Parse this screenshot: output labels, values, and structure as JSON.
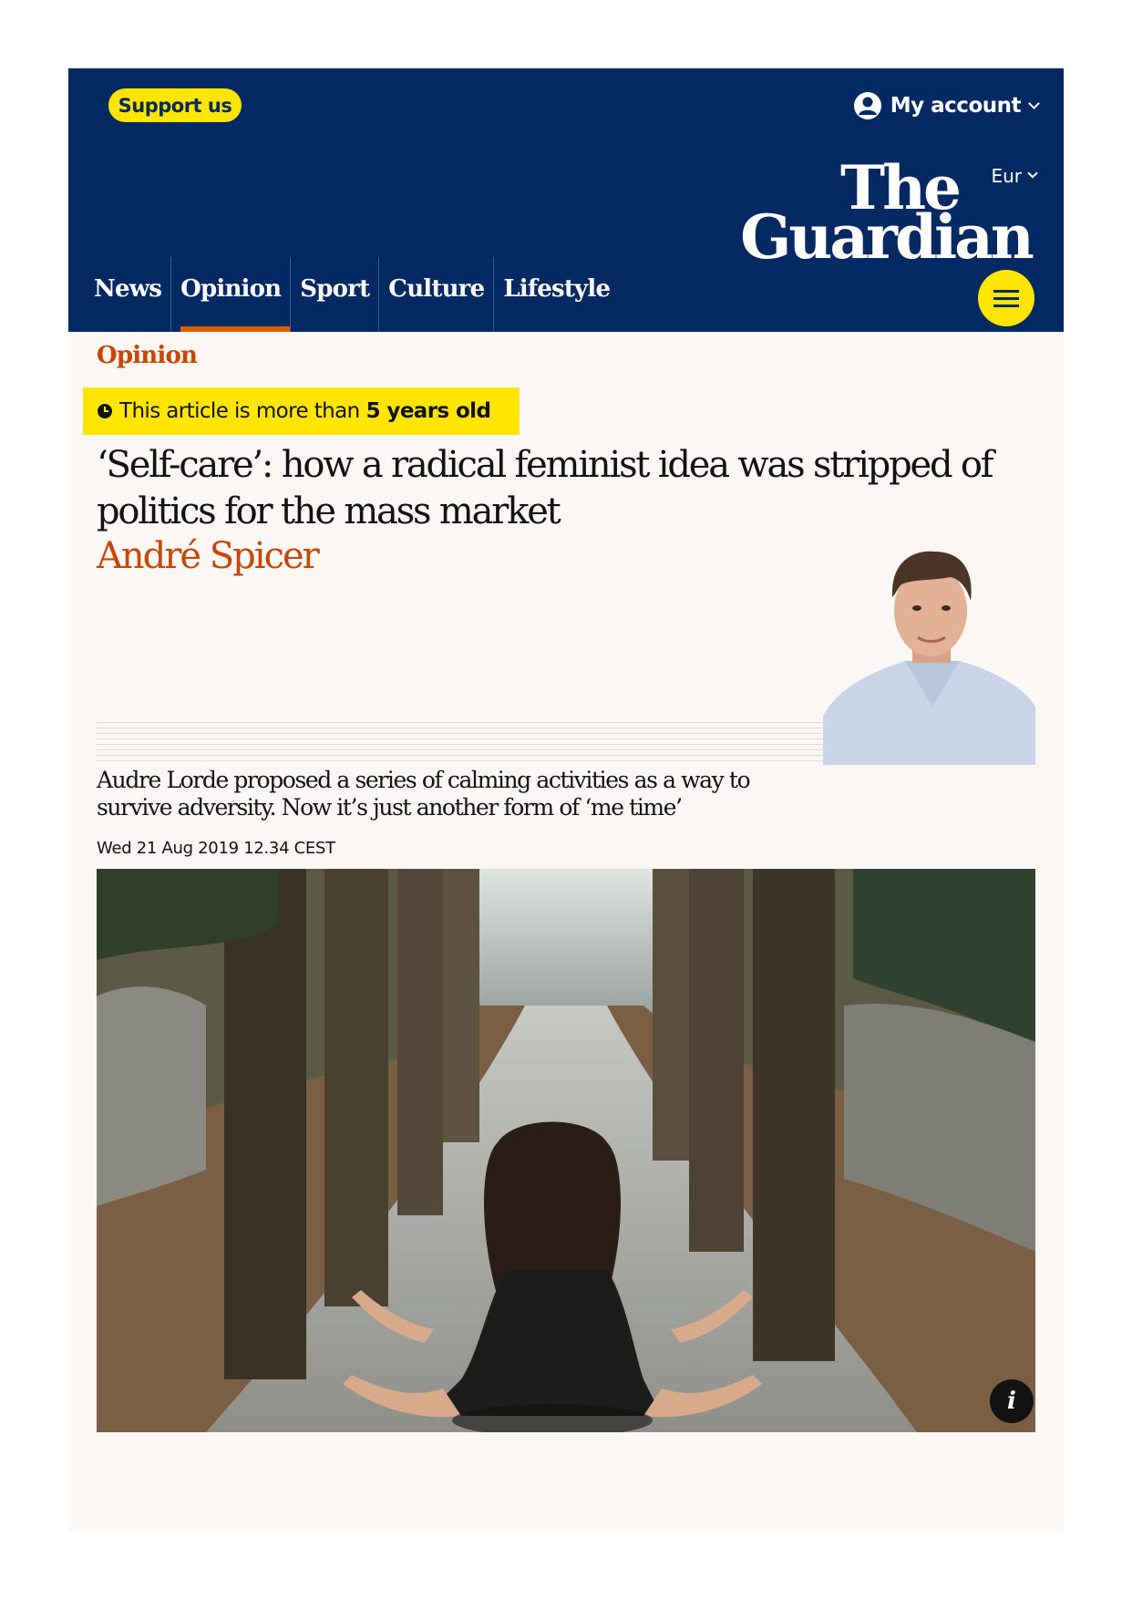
{
  "topbar": {
    "support_label": "Support us",
    "account_label": "My account"
  },
  "masthead": {
    "edition_label": "Eur",
    "logo_line1": "The",
    "logo_line2": "Guardian"
  },
  "nav": {
    "items": [
      {
        "label": "News"
      },
      {
        "label": "Opinion"
      },
      {
        "label": "Sport"
      },
      {
        "label": "Culture"
      },
      {
        "label": "Lifestyle"
      }
    ],
    "active": "Opinion"
  },
  "article": {
    "kicker": "Opinion",
    "age_notice_prefix": "This article is more than",
    "age_notice_bold": "5 years old",
    "headline": "‘Self-care’: how a radical feminist idea was stripped of politics for the mass market",
    "byline": "André Spicer",
    "standfirst": "Audre Lorde proposed a series of calming activities as a way to survive adversity. Now it’s just another form of ‘me time’",
    "dateline": "Wed 21 Aug 2019 12.34 CEST",
    "image_info_label": "i"
  },
  "colors": {
    "brand_navy": "#052962",
    "highlight_yellow": "#ffe500",
    "opinion_orange": "#c74600",
    "nav_active_underline": "#e05e00",
    "page_background": "#fbf7f4"
  }
}
